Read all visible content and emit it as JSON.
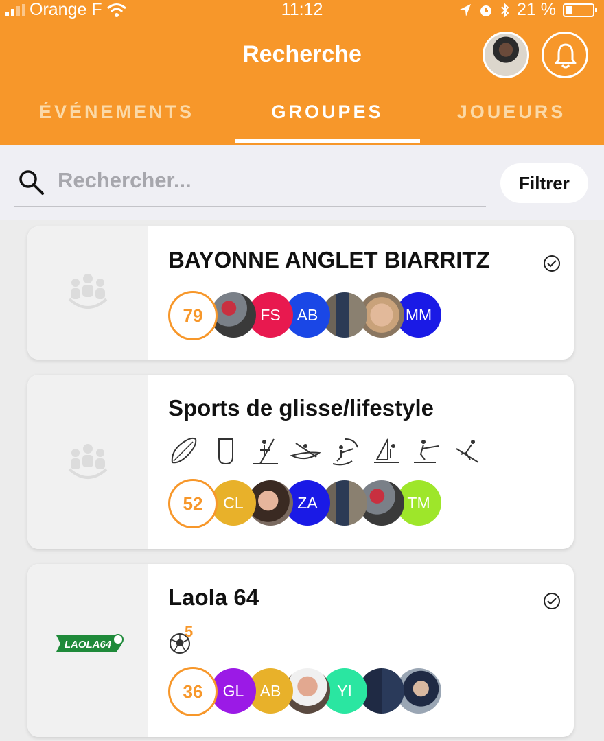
{
  "status_bar": {
    "carrier": "Orange F",
    "time": "11:12",
    "battery": "21 %"
  },
  "header": {
    "title": "Recherche"
  },
  "tabs": [
    {
      "label": "ÉVÉNEMENTS",
      "active": false
    },
    {
      "label": "GROUPES",
      "active": true
    },
    {
      "label": "JOUEURS",
      "active": false
    }
  ],
  "search": {
    "placeholder": "Rechercher...",
    "value": "",
    "filter_label": "Filtrer"
  },
  "accent_color": "#f7972a",
  "groups": [
    {
      "name": "BAYONNE ANGLET BIARRITZ",
      "joined": true,
      "member_count": "79",
      "members": [
        {
          "initials": "",
          "photo": true
        },
        {
          "initials": "FS",
          "color": "#e8194f"
        },
        {
          "initials": "AB",
          "color": "#1a47e6"
        },
        {
          "initials": "",
          "photo": true
        },
        {
          "initials": "",
          "photo": true
        },
        {
          "initials": "MM",
          "color": "#1a1ae6"
        }
      ]
    },
    {
      "name": "Sports de glisse/lifestyle",
      "joined": false,
      "sports": [
        "surf-icon",
        "bodyboard-icon",
        "paddle-icon",
        "kayak-icon",
        "kitesurf-icon",
        "windsurf-icon",
        "wakeboard-icon",
        "snowboard-icon"
      ],
      "member_count": "52",
      "members": [
        {
          "initials": "CL",
          "color": "#e8b12a"
        },
        {
          "initials": "",
          "photo": true
        },
        {
          "initials": "ZA",
          "color": "#1a1ae6"
        },
        {
          "initials": "",
          "photo": true
        },
        {
          "initials": "",
          "photo": true
        },
        {
          "initials": "TM",
          "color": "#9ee62a"
        }
      ]
    },
    {
      "name": "Laola 64",
      "joined": true,
      "logo_text": "LAOLA64",
      "sport_badge": {
        "icon": "soccer-ball-icon",
        "count": "5"
      },
      "member_count": "36",
      "members": [
        {
          "initials": "GL",
          "color": "#9b1ae6"
        },
        {
          "initials": "AB",
          "color": "#e8b12a"
        },
        {
          "initials": "",
          "photo": true
        },
        {
          "initials": "YI",
          "color": "#2ae6a1"
        },
        {
          "initials": "",
          "photo": true
        },
        {
          "initials": "",
          "photo": true
        }
      ]
    }
  ]
}
